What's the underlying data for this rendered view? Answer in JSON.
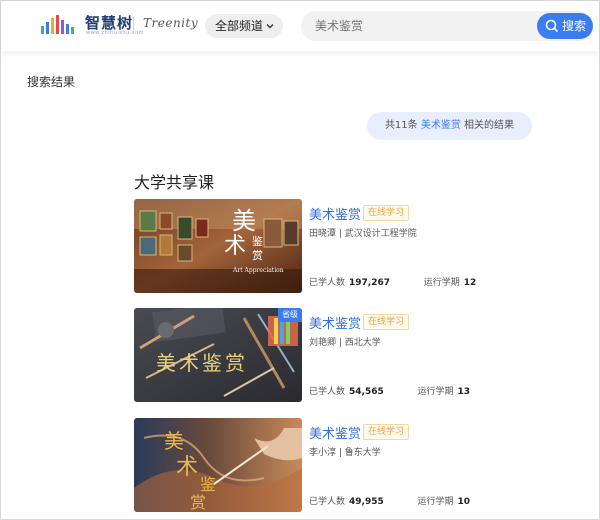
{
  "header": {
    "logo_text": "智慧树",
    "logo_url": "www.zhihuishu.com",
    "brand": "Treenity",
    "channel_label": "全部频道",
    "search_placeholder": "美术鉴赏",
    "search_button": "搜索",
    "accent_color": "#3b7cf2"
  },
  "results": {
    "title": "搜索结果",
    "count_prefix": "共11条",
    "keyword": "美术鉴赏",
    "count_suffix": "相关的结果"
  },
  "section": {
    "title": "大学共享课"
  },
  "courses": [
    {
      "name": "美术鉴赏",
      "tag": "在线学习",
      "teacher": "田晓潭 | 武汉设计工程学院",
      "learners_label": "已学人数",
      "learners": "197,267",
      "terms_label": "运行学期",
      "terms": "12",
      "thumb_title": "美术鉴赏",
      "thumb_subtitle": "Art Appreciation",
      "badge": ""
    },
    {
      "name": "美术鉴赏",
      "tag": "在线学习",
      "teacher": "刘艳卿 | 西北大学",
      "learners_label": "已学人数",
      "learners": "54,565",
      "terms_label": "运行学期",
      "terms": "13",
      "thumb_title": "美术鉴赏",
      "badge": "省级"
    },
    {
      "name": "美术鉴赏",
      "tag": "在线学习",
      "teacher": "李小淳 | 鲁东大学",
      "learners_label": "已学人数",
      "learners": "49,955",
      "terms_label": "运行学期",
      "terms": "10",
      "thumb_title": "美术鉴赏",
      "badge": ""
    }
  ]
}
